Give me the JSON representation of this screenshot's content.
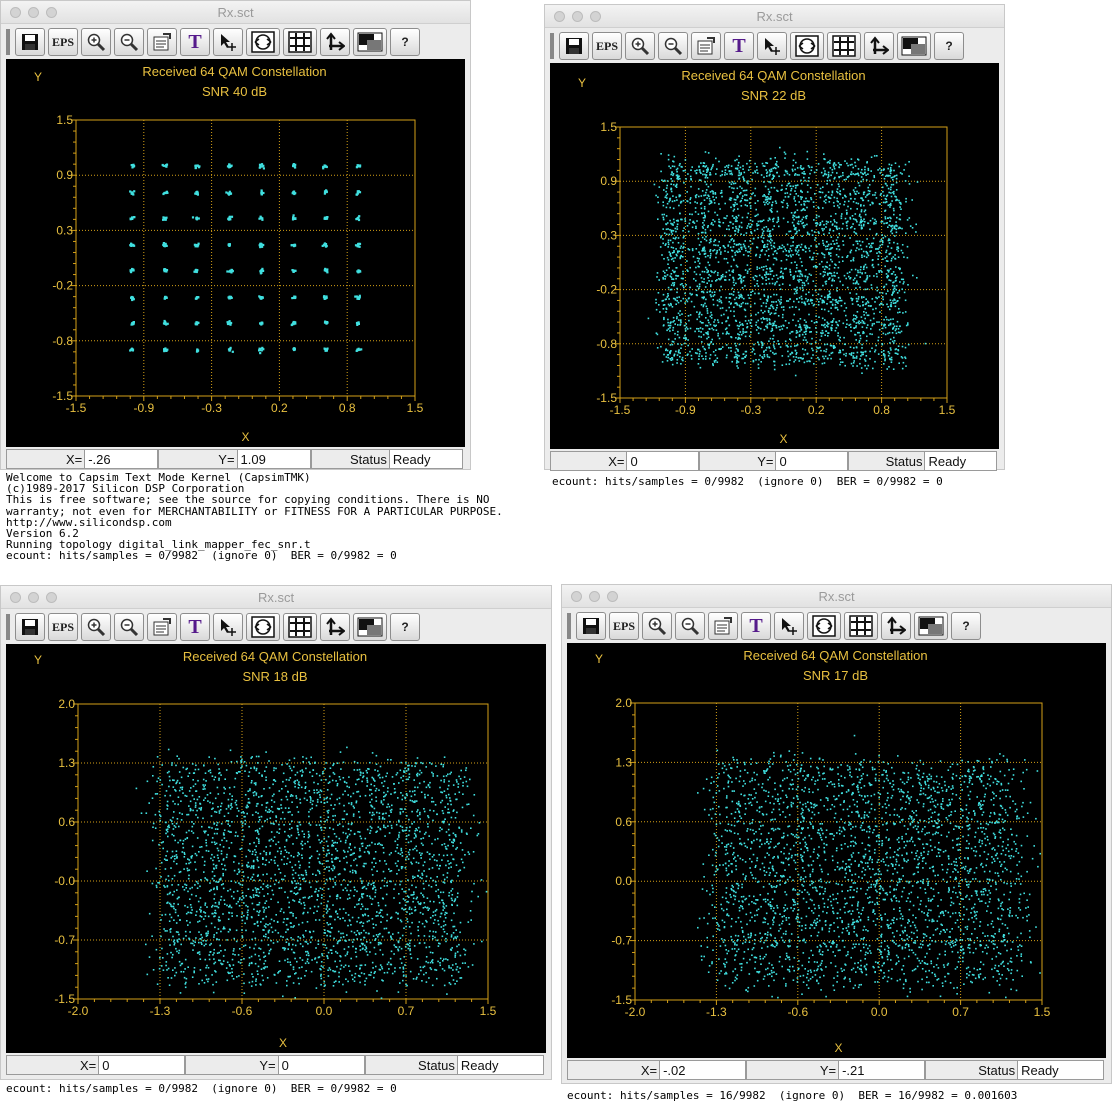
{
  "windows": [
    {
      "title": "Rx.sct",
      "plot_title": "Received 64 QAM Constellation",
      "snr_label": "SNR 40 dB",
      "ylabel": "Y",
      "xlabel": "X",
      "status": {
        "x_label": "X=",
        "x_value": "-.26",
        "y_label": "Y=",
        "y_value": "1.09",
        "status_label": "Status",
        "status_value": "Ready"
      },
      "console": [
        "Welcome to Capsim Text Mode Kernel (CapsimTMK)",
        "(c)1989-2017 Silicon DSP Corporation",
        "This is free software; see the source for copying conditions. There is NO",
        "warranty; not even for MERCHANTABILITY or FITNESS FOR A PARTICULAR PURPOSE.",
        "http://www.silicondsp.com",
        "Version 6.2",
        "Running topology digital_link_mapper_fec_snr.t",
        "ecount: hits/samples = 0/9982  (ignore 0)  BER = 0/9982 = 0"
      ]
    },
    {
      "title": "Rx.sct",
      "plot_title": "Received 64 QAM Constellation",
      "snr_label": "SNR 22 dB",
      "ylabel": "Y",
      "xlabel": "X",
      "status": {
        "x_label": "X=",
        "x_value": "0",
        "y_label": "Y=",
        "y_value": "0",
        "status_label": "Status",
        "status_value": "Ready"
      },
      "console": [
        "ecount: hits/samples = 0/9982  (ignore 0)  BER = 0/9982 = 0"
      ]
    },
    {
      "title": "Rx.sct",
      "plot_title": "Received 64 QAM Constellation",
      "snr_label": "SNR 18 dB",
      "ylabel": "Y",
      "xlabel": "X",
      "status": {
        "x_label": "X=",
        "x_value": "0",
        "y_label": "Y=",
        "y_value": "0",
        "status_label": "Status",
        "status_value": "Ready"
      },
      "console": [
        "ecount: hits/samples = 0/9982  (ignore 0)  BER = 0/9982 = 0"
      ]
    },
    {
      "title": "Rx.sct",
      "plot_title": "Received 64 QAM Constellation",
      "snr_label": "SNR 17 dB",
      "ylabel": "Y",
      "xlabel": "X",
      "status": {
        "x_label": "X=",
        "x_value": "-.02",
        "y_label": "Y=",
        "y_value": "-.21",
        "status_label": "Status",
        "status_value": "Ready"
      },
      "console": [
        "ecount: hits/samples = 16/9982  (ignore 0)  BER = 16/9982 = 0.001603"
      ]
    }
  ],
  "toolbar": {
    "buttons": [
      {
        "name": "save-icon"
      },
      {
        "name": "eps-button",
        "label": "EPS"
      },
      {
        "name": "zoom-in-icon"
      },
      {
        "name": "zoom-out-icon"
      },
      {
        "name": "properties-icon"
      },
      {
        "name": "text-icon",
        "label": "T"
      },
      {
        "name": "cursor-crosshair-icon"
      },
      {
        "name": "fit-circle-icon"
      },
      {
        "name": "grid-icon"
      },
      {
        "name": "axes-icon"
      },
      {
        "name": "color-toggle-icon"
      },
      {
        "name": "help-button",
        "label": "?"
      }
    ]
  },
  "colors": {
    "points": "#40e0e0",
    "grid": "#d4a017",
    "text": "#e8c040",
    "background": "#000000"
  },
  "chart_data": [
    {
      "type": "scatter",
      "title": "Received 64 QAM Constellation",
      "subtitle": "SNR 40 dB",
      "xlabel": "X",
      "ylabel": "Y",
      "xlim": [
        -1.5,
        1.5
      ],
      "ylim": [
        -1.5,
        1.5
      ],
      "xticks": [
        "-1.5",
        "-0.9",
        "-0.3",
        "0.2",
        "0.8",
        "1.5"
      ],
      "yticks": [
        "1.5",
        "0.9",
        "0.3",
        "-0.2",
        "-0.8",
        "-1.5"
      ],
      "grid": true,
      "points_per_symbol": 8,
      "levels": [
        -1.0,
        -0.71,
        -0.43,
        -0.14,
        0.14,
        0.43,
        0.71,
        1.0
      ],
      "noise_sigma": 0.01,
      "x_shift": 0.0
    },
    {
      "type": "scatter",
      "title": "Received 64 QAM Constellation",
      "subtitle": "SNR 22 dB",
      "xlabel": "X",
      "ylabel": "Y",
      "xlim": [
        -1.5,
        1.5
      ],
      "ylim": [
        -1.5,
        1.5
      ],
      "xticks": [
        "-1.5",
        "-0.9",
        "-0.3",
        "0.2",
        "0.8",
        "1.5"
      ],
      "yticks": [
        "1.5",
        "0.9",
        "0.3",
        "-0.2",
        "-0.8",
        "-1.5"
      ],
      "grid": true,
      "points_per_symbol": 50,
      "levels": [
        -1.0,
        -0.71,
        -0.43,
        -0.14,
        0.14,
        0.43,
        0.71,
        1.0
      ],
      "noise_sigma": 0.08,
      "x_shift": 0.0
    },
    {
      "type": "scatter",
      "title": "Received 64 QAM Constellation",
      "subtitle": "SNR 18 dB",
      "xlabel": "X",
      "ylabel": "Y",
      "xlim": [
        -2.0,
        1.5
      ],
      "ylim": [
        -1.5,
        2.0
      ],
      "xticks": [
        "-2.0",
        "-1.3",
        "-0.6",
        "0.0",
        "0.7",
        "1.5"
      ],
      "yticks": [
        "2.0",
        "1.3",
        "0.6",
        "-0.0",
        "-0.7",
        "-1.5"
      ],
      "grid": true,
      "points_per_symbol": 45,
      "levels": [
        -1.15,
        -0.82,
        -0.49,
        -0.16,
        0.16,
        0.49,
        0.82,
        1.15
      ],
      "noise_sigma": 0.12,
      "x_shift": 0.0
    },
    {
      "type": "scatter",
      "title": "Received 64 QAM Constellation",
      "subtitle": "SNR 17 dB",
      "xlabel": "X",
      "ylabel": "Y",
      "xlim": [
        -2.0,
        1.5
      ],
      "ylim": [
        -1.5,
        2.0
      ],
      "xticks": [
        "-2.0",
        "-1.3",
        "-0.6",
        "0.0",
        "0.7",
        "1.5"
      ],
      "yticks": [
        "2.0",
        "1.3",
        "0.6",
        "0.0",
        "-0.7",
        "-1.5"
      ],
      "grid": true,
      "points_per_symbol": 45,
      "levels": [
        -1.15,
        -0.82,
        -0.49,
        -0.16,
        0.16,
        0.49,
        0.82,
        1.15
      ],
      "noise_sigma": 0.13,
      "x_shift": 0.0
    }
  ]
}
